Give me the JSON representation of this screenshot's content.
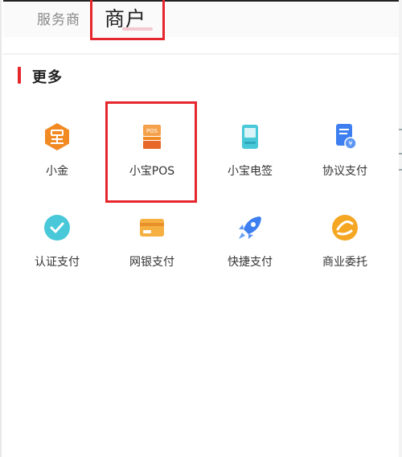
{
  "tabs": {
    "service": "服务商",
    "merchant": "商户"
  },
  "section": {
    "title": "更多"
  },
  "grid": [
    {
      "label": "小金",
      "icon": "hexagon-coin-icon"
    },
    {
      "label": "小宝POS",
      "icon": "pos-terminal-icon"
    },
    {
      "label": "小宝电签",
      "icon": "e-sign-device-icon"
    },
    {
      "label": "协议支付",
      "icon": "agreement-payment-icon"
    },
    {
      "label": "认证支付",
      "icon": "check-circle-icon"
    },
    {
      "label": "网银支付",
      "icon": "bank-card-icon"
    },
    {
      "label": "快捷支付",
      "icon": "rocket-icon"
    },
    {
      "label": "商业委托",
      "icon": "business-entrust-icon"
    }
  ],
  "colors": {
    "accent": "#e5262d",
    "orange": "#f28a24",
    "blue": "#3d7ff0",
    "teal": "#48c8d8"
  }
}
